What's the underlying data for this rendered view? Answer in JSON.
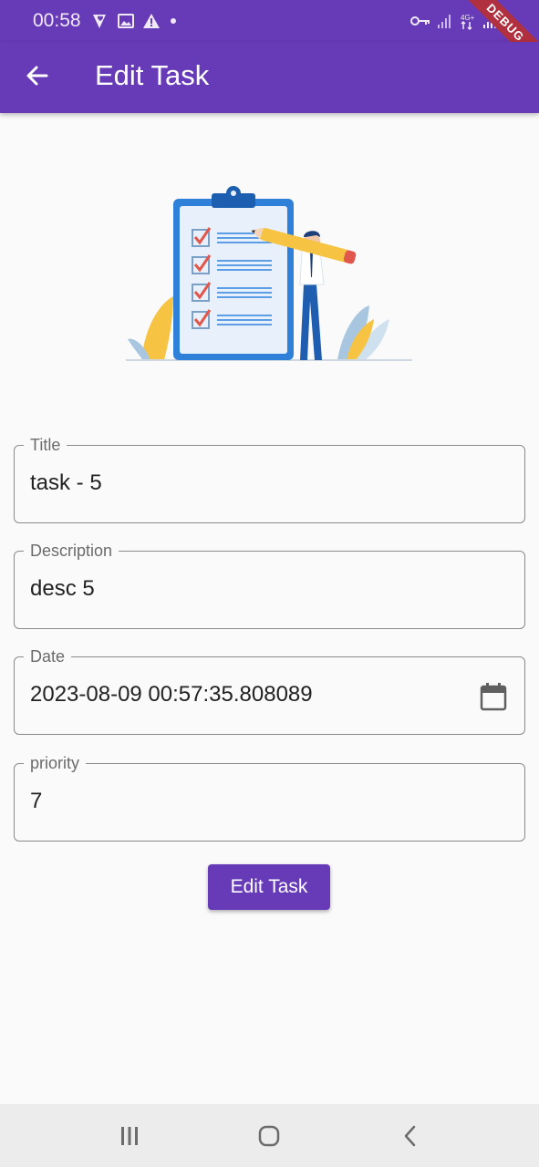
{
  "status_bar": {
    "time": "00:58",
    "left_icons": [
      "location-heart-icon",
      "image-icon",
      "warning-icon",
      "dot-icon"
    ],
    "right_icons": [
      "vpn-key-icon",
      "signal-icon",
      "network-4g-icon",
      "signal-icon",
      "battery-icon"
    ]
  },
  "app_bar": {
    "title": "Edit Task",
    "back_icon": "arrow-back-icon",
    "background": "#673ab7"
  },
  "debug_banner": "DEBUG",
  "form": {
    "title": {
      "label": "Title",
      "value": "task - 5"
    },
    "description": {
      "label": "Description",
      "value": "desc 5"
    },
    "date": {
      "label": "Date",
      "value": "2023-08-09 00:57:35.808089",
      "icon": "calendar-icon"
    },
    "priority": {
      "label": "priority",
      "value": "7"
    }
  },
  "submit_button": {
    "label": "Edit Task",
    "color": "#673ab7"
  },
  "nav_bar": {
    "recents_icon": "recents-icon",
    "home_icon": "home-icon",
    "back_icon": "nav-back-icon"
  }
}
